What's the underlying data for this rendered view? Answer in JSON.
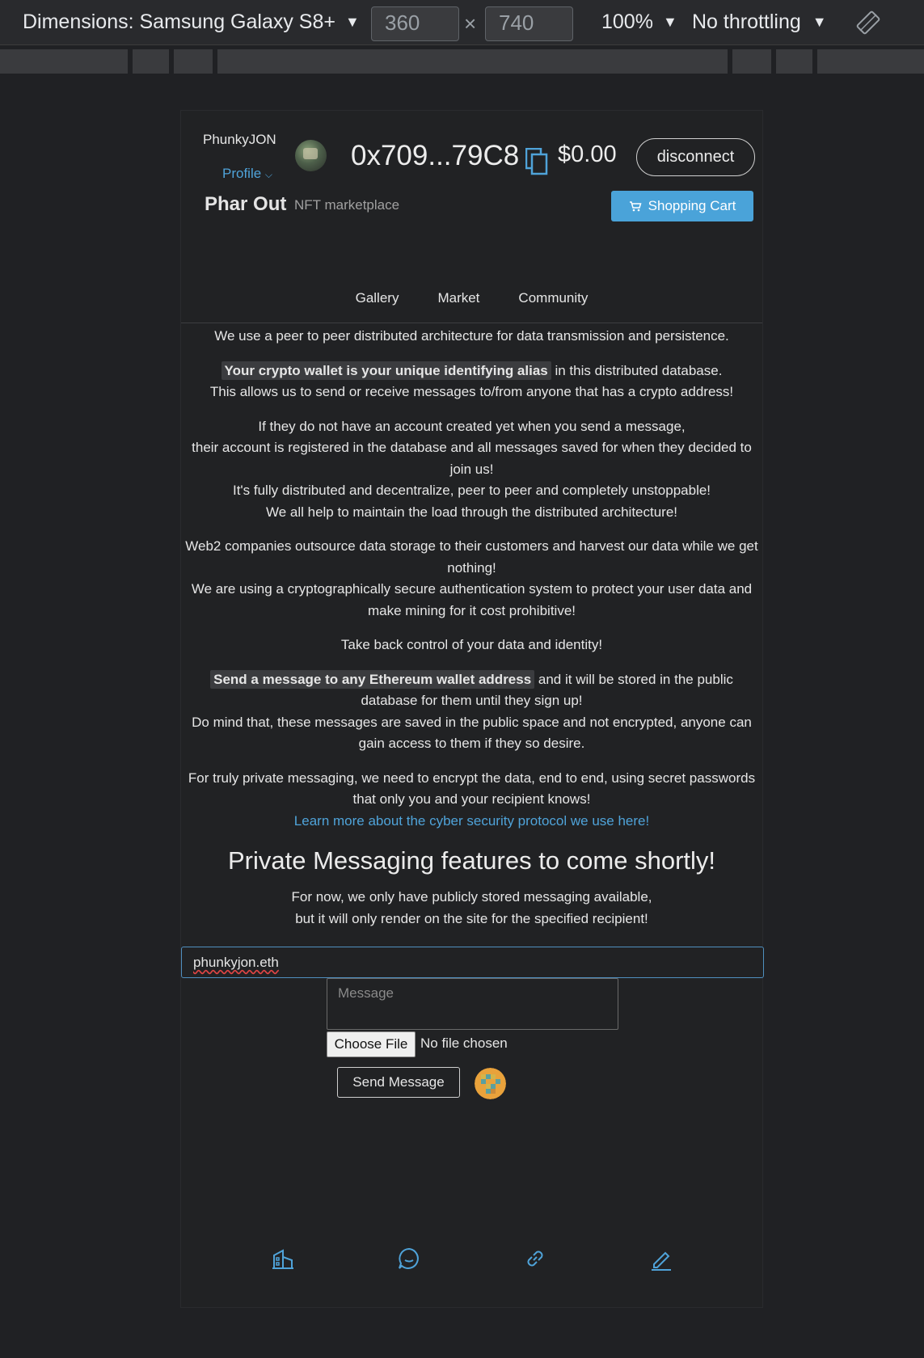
{
  "devtools": {
    "dimensions_label": "Dimensions: Samsung Galaxy S8+",
    "width": "360",
    "height": "740",
    "times": "×",
    "zoom": "100%",
    "throttling": "No throttling",
    "caret": "▼"
  },
  "header": {
    "username": "PhunkyJON",
    "profile_label": "Profile",
    "profile_caret": "⌵",
    "address": "0x709...79C8",
    "balance": "$0.00",
    "disconnect_label": "disconnect",
    "brand": "Phar Out",
    "tagline": "NFT marketplace",
    "cart_label": "Shopping Cart"
  },
  "nav": {
    "items": [
      {
        "label": "Gallery"
      },
      {
        "label": "Market"
      },
      {
        "label": "Community"
      }
    ]
  },
  "content": {
    "intro": "We use a peer to peer distributed architecture for data transmission and persistence.",
    "alias_highlight": "Your crypto wallet is your unique identifying alias",
    "alias_rest": " in this distributed database.",
    "alias_line2": "This allows us to send or receive messages to/from anyone that has a crypto address!",
    "para2_line1": "If they do not have an account created yet when you send a message,",
    "para2_line2": "their account is registered in the database and all messages saved for when they decided to join us!",
    "para2_line3": "It's fully distributed and decentralize, peer to peer and completely unstoppable!",
    "para2_line4": "We all help to maintain the load through the distributed architecture!",
    "para3_line1": "Web2 companies outsource data storage to their customers and harvest our data while we get nothing!",
    "para3_line2": "We are using a cryptographically secure authentication system to protect your user data and make mining for it cost prohibitive!",
    "para4": "Take back control of your data and identity!",
    "send_highlight": "Send a message to any Ethereum wallet address",
    "send_rest": " and it will be stored in the public database for them until they sign up!",
    "send_line2": "Do mind that, these messages are saved in the public space and not encrypted, anyone can gain access to them if they so desire.",
    "private_line1": "For truly private messaging, we need to encrypt the data, end to end, using secret passwords that only you and your recipient knows!",
    "learn_more": "Learn more about the cyber security protocol we use here!",
    "heading": "Private Messaging features to come shortly!",
    "note_line1": "For now, we only have publicly stored messaging available,",
    "note_line2": "but it will only render on the site for the specified recipient!"
  },
  "form": {
    "recipient_value": "phunkyjon.eth",
    "message_placeholder": "Message",
    "choose_file_label": "Choose File",
    "no_file_label": "No file chosen",
    "send_label": "Send Message"
  },
  "bottom_nav": {
    "icons": [
      "building-icon",
      "chat-icon",
      "link-icon",
      "pencil-icon"
    ]
  },
  "colors": {
    "accent": "#4aa3d9",
    "background": "#212224",
    "highlight_bg": "#3b3c3f"
  }
}
